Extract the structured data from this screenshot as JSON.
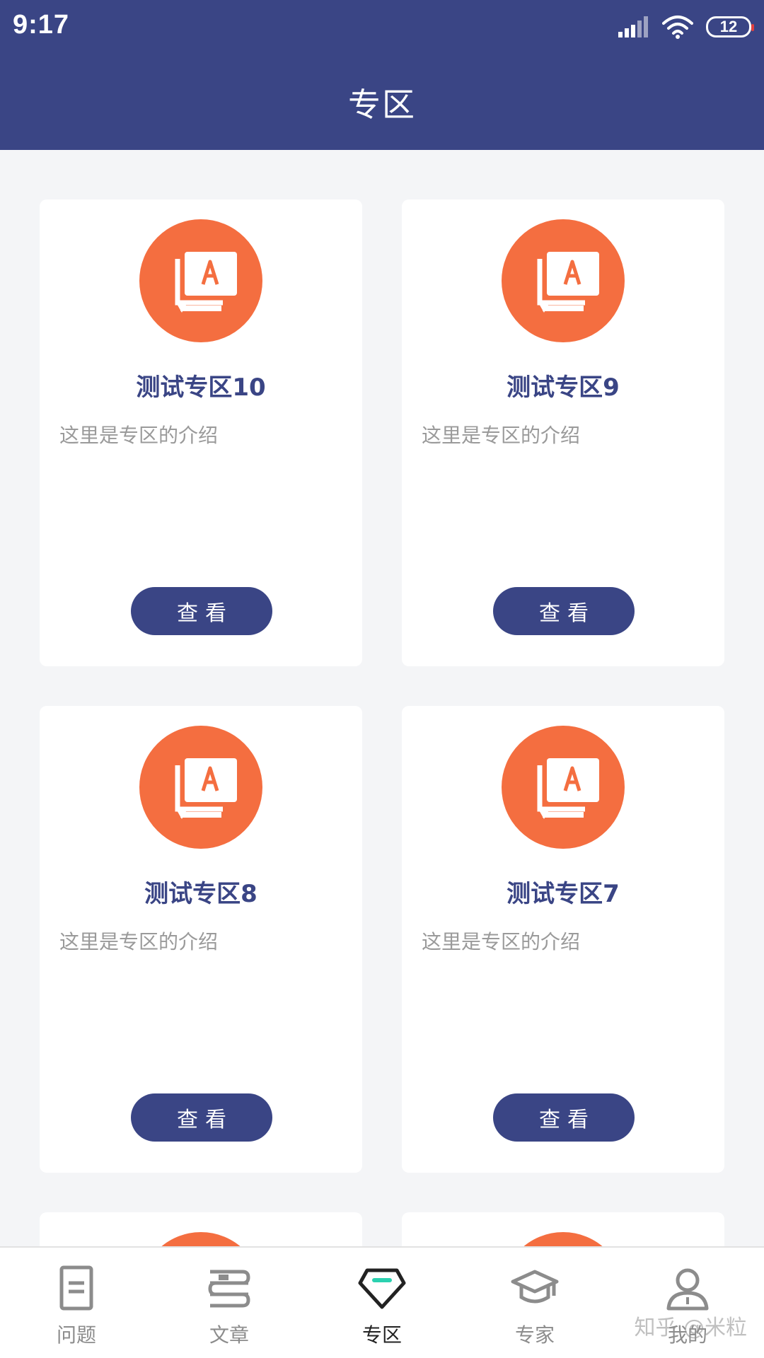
{
  "status_bar": {
    "time": "9:17",
    "battery": "12",
    "icons": [
      "signal-icon",
      "wifi-icon",
      "battery-icon"
    ]
  },
  "header": {
    "title": "专区"
  },
  "colors": {
    "primary": "#3a4585",
    "accent": "#f46e40",
    "tab_active_indicator": "#2bd1b0",
    "background": "#f4f5f7"
  },
  "cards": [
    {
      "title": "测试专区10",
      "description": "这里是专区的介绍",
      "button": "查看",
      "icon": "chat-a-icon"
    },
    {
      "title": "测试专区9",
      "description": "这里是专区的介绍",
      "button": "查看",
      "icon": "chat-a-icon"
    },
    {
      "title": "测试专区8",
      "description": "这里是专区的介绍",
      "button": "查看",
      "icon": "chat-a-icon"
    },
    {
      "title": "测试专区7",
      "description": "这里是专区的介绍",
      "button": "查看",
      "icon": "chat-a-icon"
    }
  ],
  "tabs": [
    {
      "label": "问题",
      "icon": "document-icon",
      "active": false
    },
    {
      "label": "文章",
      "icon": "books-icon",
      "active": false
    },
    {
      "label": "专区",
      "icon": "gem-icon",
      "active": true
    },
    {
      "label": "专家",
      "icon": "graduation-cap-icon",
      "active": false
    },
    {
      "label": "我的",
      "icon": "user-icon",
      "active": false
    }
  ],
  "watermark": "知乎 @米粒"
}
